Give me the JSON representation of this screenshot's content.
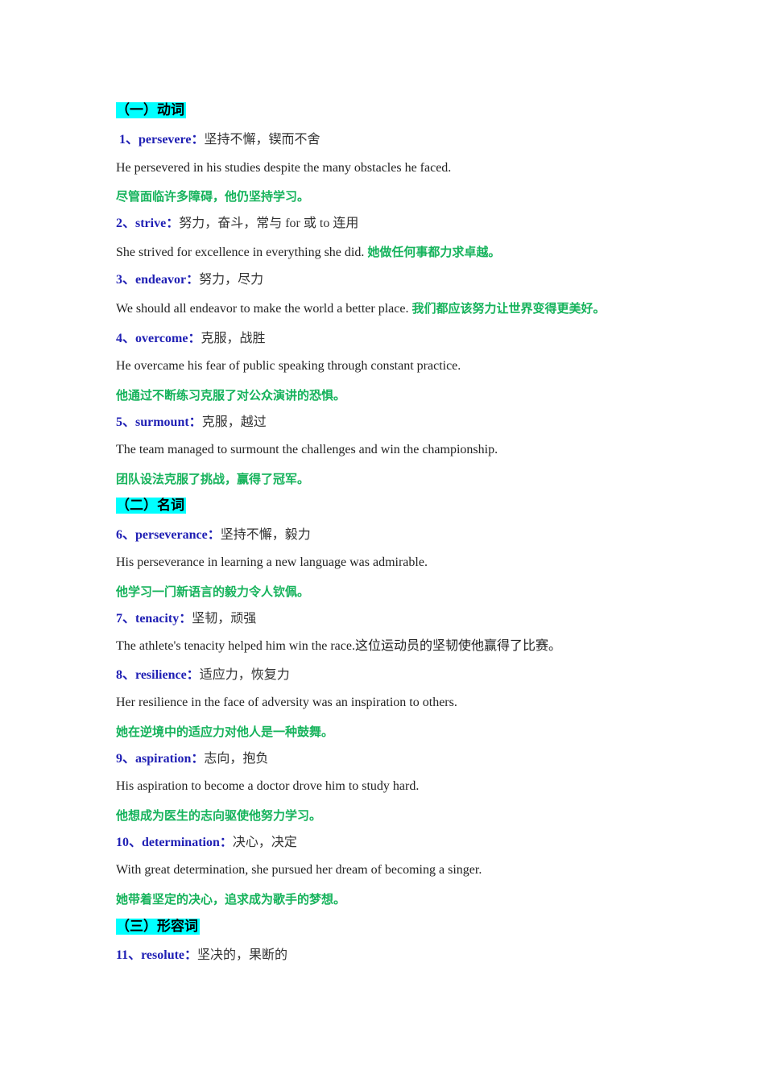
{
  "sections": [
    {
      "title": "（一）动词"
    },
    {
      "title": "（二）名词"
    },
    {
      "title": "（三）形容词"
    }
  ],
  "entries": [
    {
      "term": "1、persevere：",
      "meaning": "坚持不懈，锲而不舍",
      "example": "He persevered in his studies despite the many obstacles he faced.",
      "translation": "尽管面临许多障碍，他仍坚持学习。"
    },
    {
      "term": "2、strive：",
      "meaning": "努力，奋斗，常与  for 或  to 连用",
      "example": "She strived for excellence in everything she did. ",
      "translation": "她做任何事都力求卓越。"
    },
    {
      "term": "3、endeavor：",
      "meaning": "努力，尽力",
      "example": "We should all endeavor to make the world a better place. ",
      "translation": "我们都应该努力让世界变得更美好。"
    },
    {
      "term": "4、overcome：",
      "meaning": "克服，战胜",
      "example": "He overcame his fear of public speaking through constant practice.",
      "translation": "他通过不断练习克服了对公众演讲的恐惧。"
    },
    {
      "term": "5、surmount：",
      "meaning": "克服，越过",
      "example": "The team managed to surmount the challenges and win the championship.",
      "translation": "团队设法克服了挑战，赢得了冠军。"
    },
    {
      "term": "6、perseverance：",
      "meaning": "坚持不懈，毅力",
      "example": "His perseverance in learning a new language was admirable.",
      "translation": "他学习一门新语言的毅力令人钦佩。"
    },
    {
      "term": "7、tenacity：",
      "meaning": "坚韧，顽强",
      "example": "The athlete's tenacity helped him win the race.",
      "translation": "这位运动员的坚韧使他赢得了比赛。"
    },
    {
      "term": "8、resilience：",
      "meaning": "适应力，恢复力",
      "example": "Her resilience in the face of adversity was an inspiration to others.",
      "translation": "她在逆境中的适应力对他人是一种鼓舞。"
    },
    {
      "term": "9、aspiration：",
      "meaning": "志向，抱负",
      "example": "His aspiration to become a doctor drove him to study hard.",
      "translation": "他想成为医生的志向驱使他努力学习。"
    },
    {
      "term": "10、determination：",
      "meaning": "决心，决定",
      "example": "With great determination, she pursued her dream of becoming a singer.",
      "translation": "她带着坚定的决心，追求成为歌手的梦想。"
    },
    {
      "term": "11、resolute：",
      "meaning": "坚决的，果断的"
    }
  ]
}
